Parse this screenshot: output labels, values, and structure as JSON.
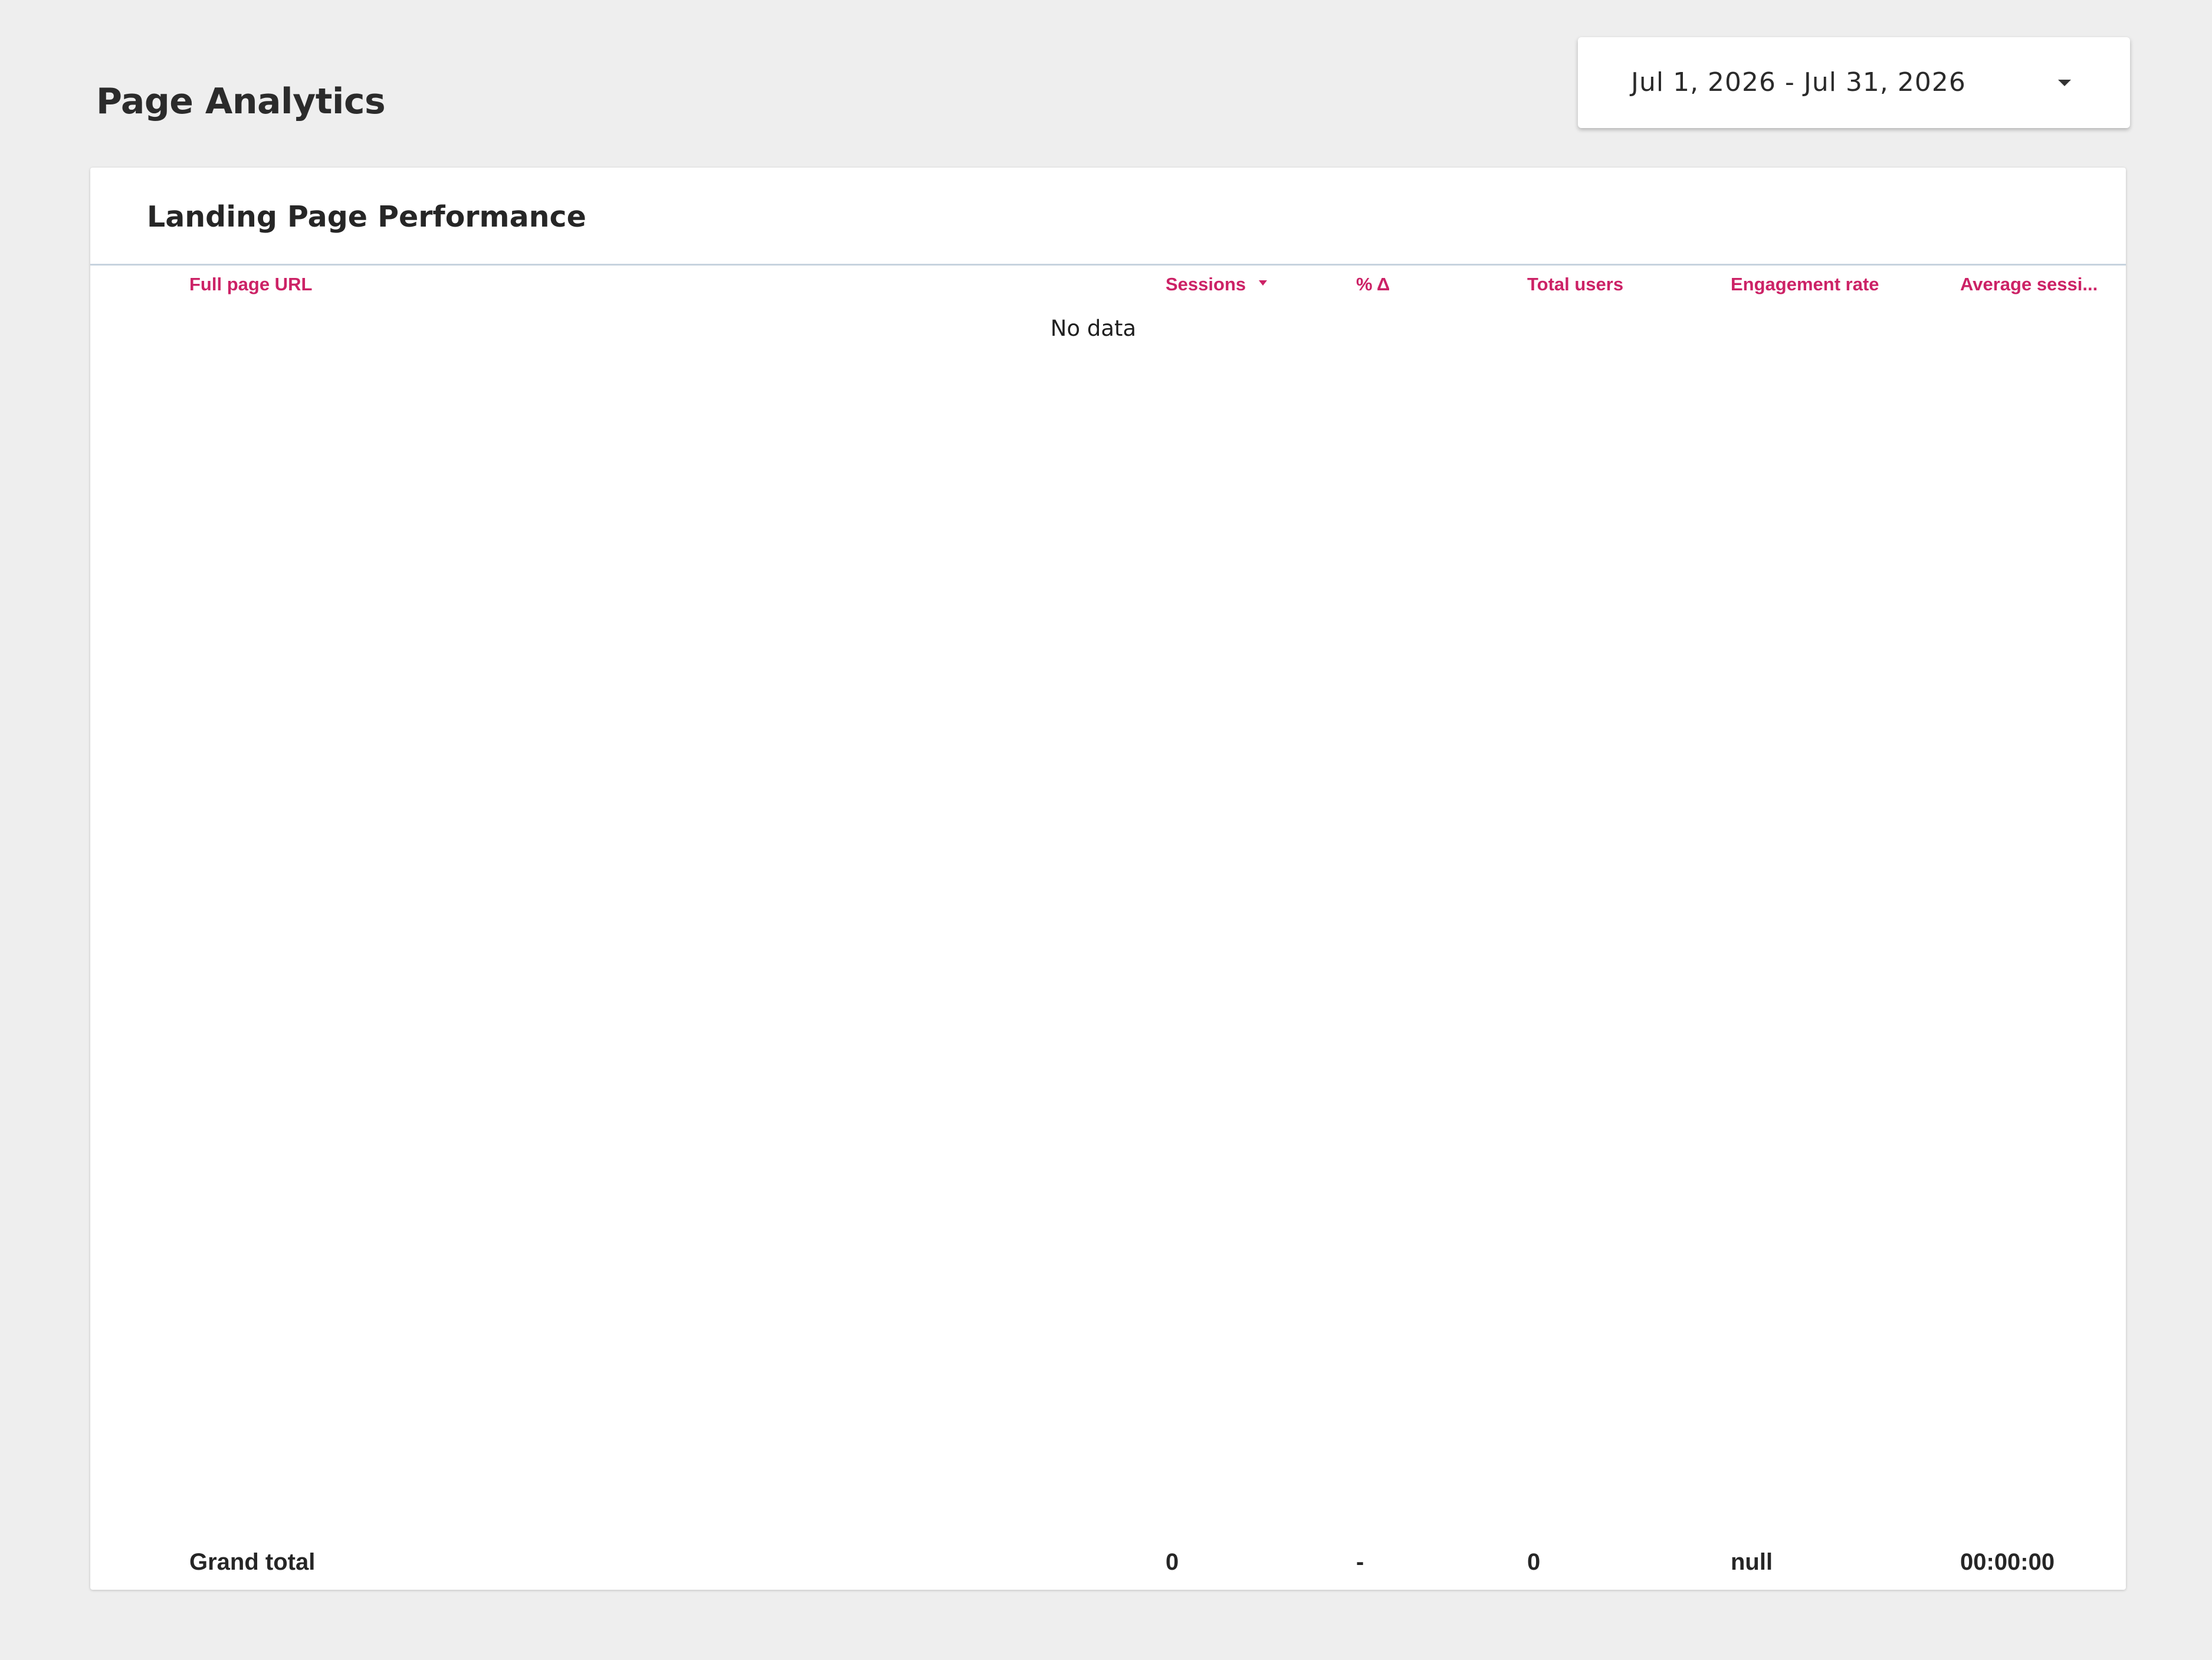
{
  "page": {
    "title": "Page Analytics"
  },
  "date_range": {
    "label": "Jul 1, 2026 - Jul 31, 2026",
    "icon": "chevron-down-icon"
  },
  "table": {
    "title": "Landing Page Performance",
    "columns": [
      {
        "label": "Full page URL"
      },
      {
        "label": "Sessions",
        "sorted": "descending"
      },
      {
        "label": "% Δ"
      },
      {
        "label": "Total users"
      },
      {
        "label": "Engagement rate"
      },
      {
        "label": "Average sessi..."
      }
    ],
    "empty_message": "No data",
    "grand_total": {
      "label": "Grand total",
      "values": [
        "0",
        "-",
        "0",
        "null",
        "00:00:00"
      ]
    }
  },
  "colors": {
    "background": "#eeeeee",
    "panel": "#ffffff",
    "header_accent": "#cc2266",
    "divider": "#c7d3de"
  }
}
